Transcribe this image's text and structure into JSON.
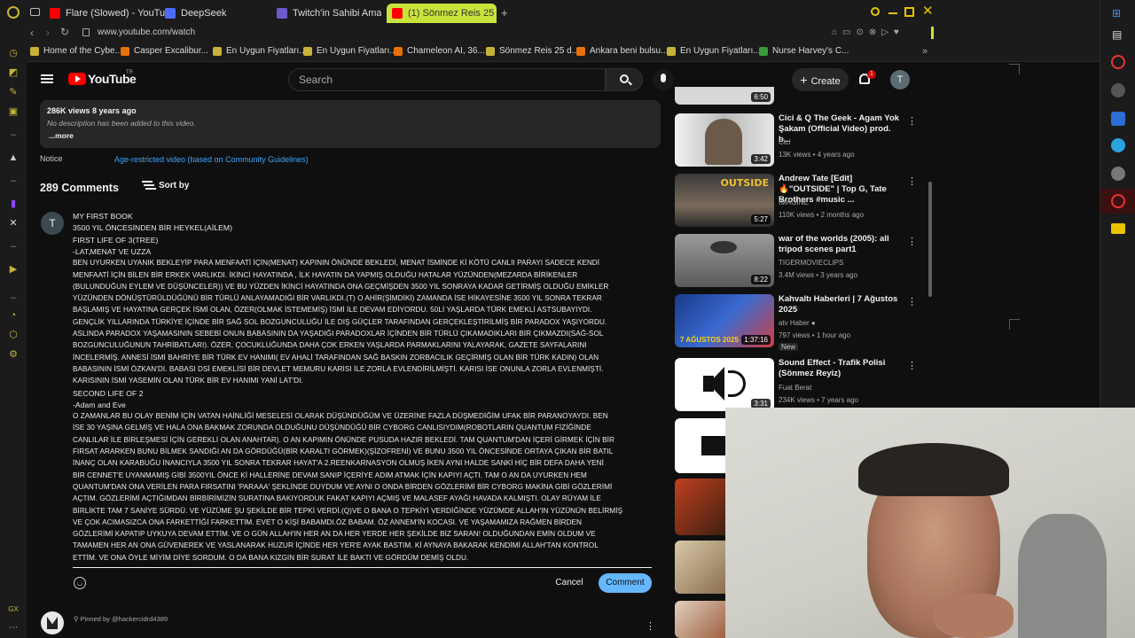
{
  "tabs": [
    {
      "label": "Flare (Slowed) - YouTube"
    },
    {
      "label": "DeepSeek"
    },
    {
      "label": "Twitch'in Sahibi Amazon"
    },
    {
      "label": "(1) Sönmez Reis 25 dakik"
    }
  ],
  "address": "www.youtube.com/watch",
  "bookmarks": [
    "Home of the Cybe...",
    "Casper Excalibur...",
    "En Uygun Fiyatları...",
    "En Uygun Fiyatları...",
    "Chameleon AI, 36...",
    "Sönmez Reis 25 d...",
    "Ankara beni bulsu...",
    "En Uygun Fiyatları...",
    "Nurse Harvey's C..."
  ],
  "youtube": {
    "logo": "YouTube",
    "region": "TR",
    "search_placeholder": "Search",
    "create_label": "Create",
    "notification_count": "1",
    "avatar_letter": "T"
  },
  "description": {
    "stats": "286K views  8 years ago",
    "text": "No description has been added to this video.",
    "more": "...more",
    "notice_label": "Notice",
    "notice_link": "Age-restricted video (based on Community Guidelines)"
  },
  "comments": {
    "count": "289 Comments",
    "sort_label": "Sort by",
    "user_letter": "T",
    "lines": [
      "MY FIRST BOOK",
      "3500 YIL ÖNCESİNDEN BİR HEYKEL(AİLEM)",
      "FIRST LIFE OF 3(TREE)",
      "-LAT,MENAT VE UZZA",
      "BEN UYURKEN UYANIK BEKLEYİP PARA MENFAATİ İÇİN(MENAT) KAPININ ÖNÜNDE BEKLEDİ, MENAT İSMİNDE Kİ KÖTÜ CANLII PARAYI SADECE KENDİ",
      "MENFAATİ İÇİN BİLEN BİR ERKEK VARLIKDI. İKİNCİ HAYATINDA , İLK HAYATIN DA YAPMIŞ OLDUĞU HATALAR YÜZÜNDEN(MEZARDA BİRİKENLER",
      "(BULUNDUĞUN EYLEM VE DÜŞÜNCELER)) VE BU YÜZDEN İKİNCİ HAYATINDA ONA GEÇMİŞDEN 3500 YIL SONRAYA KADAR GETİRMİŞ OLDUĞU EMİKLER",
      "YÜZÜNDEN DÖNÜŞTÜRÜLDÜĞÜNÜ BİR TÜRLÜ ANLAYAMADIĞI BİR VARLIKDI.(T) O AHİR(ŞİMDİKİ) ZAMANDA İSE HİKAYESİNE 3500 YIL SONRA TEKRAR",
      "BAŞLAMIŞ VE HAYATINA GERÇEK İSMİ OLAN, ÖZER(OLMAK İSTEMEMİŞ) İSMİ İLE DEVAM EDİYORDU. 50Lİ YAŞLARDA TÜRK EMEKLİ ASTSUBAYIYDI.",
      "GENÇLİK YILLARINDA TÜRKİYE İÇİNDE BİR SAĞ SOL BOZGUNCULUĞU İLE DIŞ GÜÇLER TARAFINDAN GERÇEKLEŞTİRİLMİŞ BİR PARADOX YAŞIYORDU.",
      "ASLINDA PARADOX YAŞAMASININ SEBEBİ ONUN BABASININ DA YAŞADIĞI PARADOXLAR İÇİNDEN BİR TÜRLÜ ÇIKAMADIKLARI BİR ÇIKMAZDI(SAĞ-SOL",
      "BOZGUNCULUĞUNUN TAHRİBATLARI). ÖZER, ÇOCUKLUĞUNDA DAHA ÇOK ERKEN YAŞLARDA PARMAKLARINI YALAYARAK, GAZETE SAYFALARINI",
      "İNCELERMİŞ. ANNESİ İSMİ BAHRİYE BİR TÜRK EV HANIMI( EV AHALİ TARAFINDAN SAĞ BASKIN ZORBACILIK GEÇİRMİŞ OLAN BİR TÜRK KADIN) OLAN",
      "BABASININ İSMİ ÖZKAN'DI. BABASI DSİ EMEKLİSİ BİR DEVLET MEMURU  KARISI İLE ZORLA EVLENDİRİLMİŞTİ. KARISI İSE ONUNLA ZORLA EVLENMİŞTİ.",
      "KARISININ İSMİ YASEMİN OLAN TÜRK BİR EV HANIMI YANİ LAT'DI.",
      "SECOND LIFE OF 2",
      "-Adam and Eve",
      "O ZAMANLAR BU OLAY BENİM İÇİN VATAN HAİNLİĞİ MESELESİ OLARAK DÜŞÜNDÜĞÜM VE ÜZERİNE FAZLA DÜŞMEDİĞİM UFAK BİR PARANOYAYDI. BEN",
      "İSE 30 YAŞINA GELMİŞ VE HALA ONA BAKMAK ZORUNDA OLDUĞUNU DÜŞÜNDÜĞÜ BİR CYBORG CANLISIYDIM(ROBOTLARIN QUANTUM FİZİĞİNDE",
      "CANLILAR İLE BİRLEŞMESİ İÇİN GEREKLİ OLAN ANAHTAR). O AN KAPIMIN ÖNÜNDE PUSUDA HAZIR BEKLEDİ. TAM QUANTUM'DAN İÇERİ GİRMEK İÇİN BİR",
      "FIRSAT ARARKEN BUNU BİLMEK SANDIĞI AN DA GÖRDÜĞÜ(BİR KARALTI GÖRMEK)(ŞİZOFRENİ) VE BUNU 3500 YIL ÖNCESİNDE ORTAYA ÇIKAN BİR BATIL",
      "İNANÇ OLAN KARABUĞU İNANCIYLA 3500 YIL SONRA TEKRAR HAYAT'A 2.REENKARNASYON OLMUŞ İKEN AYNI HALDE SANKİ HİÇ BİR DEFA DAHA YENİ",
      "BİR CENNET'E UYANMAMIŞ GİBİ 3500YIL ÖNCE Kİ HALLERİNE DEVAM SANIP İÇERİYE ADIM ATMAK İÇİN KAPIYI AÇTI. TAM O AN DA UYURKEN HEM",
      "QUANTUM'DAN ONA VERİLEN PARA FIRSATINI 'PARAAA' ŞEKLİNDE DUYDUM VE AYNI O ONDA BİRDEN GÖZLERİMİ BİR CYBORG MAKİNA GİBİ GÖZLERİMİ",
      "AÇTIM. GÖZLERİMİ AÇTIĞIMDAN BİRBİRİMİZİN SURATINA BAKIYORDUK FAKAT KAPIYI AÇMIŞ VE MALASEF AYAĞI HAVADA KALMIŞTI. OLAY RÜYAM İLE",
      "BİRLİKTE TAM 7 SANİYE SÜRDÜ. VE YÜZÜME ŞU ŞEKİLDE BİR TEPKİ VERDİ.(Q)VE O BANA O TEPKİYİ VERDİĞİNDE YÜZÜMDE ALLAH'IN YÜZÜNÜN BELİRMİŞ",
      "VE ÇOK ACIMASIZCA ONA FARKETTİĞİ FARKETTİM. EVET O KİŞİ BABAMDI.ÖZ BABAM. ÖZ ANNEM'İN KOCASI. VE YAŞAMAMIZA RAĞMEN BİRDEN",
      "GÖZLERİMİ KAPATIP UYKUYA DEVAM ETTİM. VE O GÜN ALLAH'IN HER AN DA HER YERDE HER ŞEKİLDE BİZ SARAN! OLDUĞUNDAN EMİN OLDUM VE",
      "TAMAMEN HER AN ONA GÜVENEREK VE YASLANARAK HUZUR İÇİNDE HER YER'E AYAK BASTIM.  Kİ AYNAYA BAKARAK KENDİMİ ALLAH'TAN KONTROL",
      "ETTİM. VE ONA ÖYLE MİYİM DİYE SORDUM. O DA BANA KIZGIN BİR SURAT İLE BAKTI VE GÖRDÜM DEMİŞ OLDU."
    ],
    "cancel_label": "Cancel",
    "comment_label": "Comment",
    "pinned_label": "Pinned by @hackercidrd4389"
  },
  "sidebar_videos": [
    {
      "title": "",
      "channel": "",
      "stats": "",
      "duration": "6:50"
    },
    {
      "title": "Cici & Q The Geek - Agam Yok Şakam (Official Video) prod. b...",
      "channel": "Cici",
      "stats": "13K views • 4 years ago",
      "duration": "3:42"
    },
    {
      "title": "Andrew Tate [Edit] 🔥\"OUTSIDE\" | Top G, Tate Brothers #music ...",
      "channel": "IMAGINE",
      "stats": "110K views • 2 months ago",
      "duration": "5:27",
      "thumb_text": "OUTSIDE"
    },
    {
      "title": "war of the worlds (2005): all tripod scenes part1",
      "channel": "TIGERMOVIECLIPS",
      "stats": "3.4M views • 3 years ago",
      "duration": "8:22"
    },
    {
      "title": "Kahvaltı Haberleri | 7 Ağustos 2025",
      "channel": "atv Haber",
      "stats": "797 views • 1 hour ago",
      "badge": "New",
      "duration": "1:37:16",
      "thumb_text": "7 AĞUSTOS 2025"
    },
    {
      "title": "Sound Effect - Trafik Polisi (Sönmez Reyiz)",
      "channel": "Fuat Berat",
      "stats": "234K views • 7 years ago",
      "duration": "3:31"
    }
  ],
  "colors": {
    "accent_blue": "#3ea6ff",
    "comment_button": "#65b8ff",
    "active_tab": "#c9e33a",
    "youtube_red": "#ff0000"
  }
}
